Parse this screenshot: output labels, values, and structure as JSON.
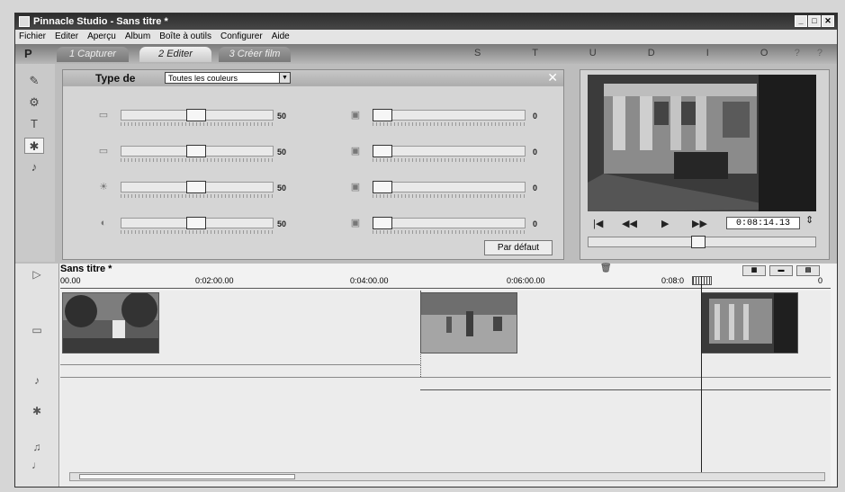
{
  "window": {
    "title": "Pinnacle Studio - Sans titre *",
    "buttons": [
      "_",
      "□",
      "✕"
    ]
  },
  "menu": [
    "Fichier",
    "Editer",
    "Aperçu",
    "Album",
    "Boîte à outils",
    "Configurer",
    "Aide"
  ],
  "modes": {
    "logo": "P",
    "tabs": [
      "1 Capturer",
      "2 Editer",
      "3 Créer film"
    ],
    "active": "2 Editer",
    "studio_text": "S T U D I O",
    "help_icons": "? ?"
  },
  "toolbox": {
    "label": "Type de",
    "select_value": "Toutes les couleurs",
    "left_sliders": [
      {
        "icon": "▭",
        "value": "50"
      },
      {
        "icon": "▭",
        "value": "50"
      },
      {
        "icon": "☀",
        "value": "50"
      },
      {
        "icon": "◐",
        "value": "50"
      }
    ],
    "right_sliders": [
      {
        "icon": "▣",
        "value": "0"
      },
      {
        "icon": "▣",
        "value": "0"
      },
      {
        "icon": "▣",
        "value": "0"
      },
      {
        "icon": "▣",
        "value": "0"
      }
    ],
    "default_button": "Par défaut"
  },
  "preview": {
    "controls": [
      "|◀",
      "◀◀",
      "▶",
      "▶▶"
    ],
    "timecode": "0:08:14.13"
  },
  "timeline": {
    "title": "Sans titre *",
    "ruler": [
      "00.00",
      "0:02:00.00",
      "0:04:00.00",
      "0:06:00.00",
      "0:08:0"
    ],
    "ruler_end": "0",
    "clips": [
      "clip-garden",
      "clip-field",
      "clip-building"
    ]
  },
  "colors": {
    "titlebar": "#3a3a3a",
    "panel": "#d5d5d5",
    "timeline": "#f2f2f2"
  },
  "icons": {
    "leftbar": [
      "edit-icon",
      "transition-icon",
      "title-icon",
      "color-icon",
      "audio-icon"
    ],
    "timeline": [
      "pointer-icon",
      "video-track-icon",
      "audio-icon",
      "effects-icon",
      "music-icon",
      "speaker-icon"
    ]
  }
}
